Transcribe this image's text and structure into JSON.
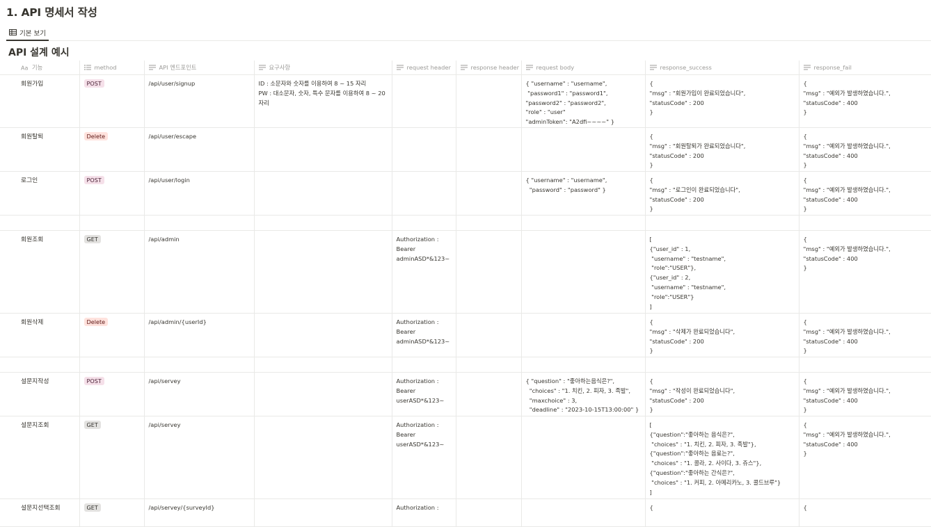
{
  "page": {
    "heading": "1. API 명세서 작성"
  },
  "view": {
    "tab_label": "기본 보기"
  },
  "database": {
    "title": "API 설계 예시"
  },
  "columns": [
    {
      "label": "기능",
      "icon": "title-aa-icon"
    },
    {
      "label": "method",
      "icon": "list-icon"
    },
    {
      "label": "API 엔드포인트",
      "icon": "text-icon"
    },
    {
      "label": "요구사항",
      "icon": "text-icon"
    },
    {
      "label": "request header",
      "icon": "text-icon"
    },
    {
      "label": "response header",
      "icon": "text-icon"
    },
    {
      "label": "request body",
      "icon": "text-icon"
    },
    {
      "label": "response_success",
      "icon": "text-icon"
    },
    {
      "label": "response_fail",
      "icon": "text-icon"
    }
  ],
  "tag_colors": {
    "POST": "#f5e0e9",
    "Delete": "#ffe2dd",
    "GET": "#e3e2e0"
  },
  "rows": [
    {
      "name": "회원가입",
      "method": "POST",
      "endpoint": "/api/user/signup",
      "requirements": "ID : 소문자와 숫자를 이용하여 8 ~ 15 자리\nPW : 대소문자, 숫자, 특수 문자를 이용하여 8 ~ 20 자리",
      "request_header": "",
      "response_header": "",
      "request_body": "{ \"username\" : \"username\",\n \"password1\" : \"password1\",\n\"password2\" : \"password2\",\n\"role\" : \"user\"\n\"adminToken\": \"A2dfi~~~~\" }",
      "response_success": "{\n\"msg\" : \"회원가입이 완료되었습니다\",\n\"statusCode\" : 200\n}",
      "response_fail": "{\n\"msg\" : \"예외가 발생하였습니다.\",\n\"statusCode\" : 400\n}"
    },
    {
      "name": "회원탈퇴",
      "method": "Delete",
      "endpoint": "/api/user/escape",
      "requirements": "",
      "request_header": "",
      "response_header": "",
      "request_body": "",
      "response_success": "{\n\"msg\" : \"회원탈퇴가 완료되었습니다\",\n\"statusCode\" : 200\n}",
      "response_fail": "{\n\"msg\" : \"예외가 발생하였습니다.\",\n\"statusCode\" : 400\n}"
    },
    {
      "name": "로그인",
      "method": "POST",
      "endpoint": "/api/user/login",
      "requirements": "",
      "request_header": "",
      "response_header": "",
      "request_body": "{ \"username\" : \"username\",\n  \"password\" : \"password\" }",
      "response_success": "{\n\"msg\" : \"로그인이 완료되었습니다\",\n\"statusCode\" : 200\n}",
      "response_fail": "{\n\"msg\" : \"예외가 발생하였습니다.\",\n\"statusCode\" : 400\n}"
    },
    {
      "name": "",
      "method": "",
      "endpoint": "",
      "requirements": "",
      "request_header": "",
      "response_header": "",
      "request_body": "",
      "response_success": "",
      "response_fail": ""
    },
    {
      "name": "회원조회",
      "method": "GET",
      "endpoint": "/api/admin",
      "requirements": "",
      "request_header": "Authorization :\nBearer\nadminASD*&123~",
      "response_header": "",
      "request_body": "",
      "response_success": "[\n{\"user_id\" : 1,\n \"username\" : \"testname\",\n \"role\":\"USER\"},\n{\"user_id\" : 2,\n \"username\" : \"testname\",\n \"role\":\"USER\"}\n]",
      "response_fail": "{\n\"msg\" : \"예외가 발생하였습니다.\",\n\"statusCode\" : 400\n}"
    },
    {
      "name": "회원삭제",
      "method": "Delete",
      "endpoint": "/api/admin/{userId}",
      "requirements": "",
      "request_header": "Authorization :\nBearer\nadminASD*&123~",
      "response_header": "",
      "request_body": "",
      "response_success": "{\n\"msg\" : \"삭제가 완료되었습니다\",\n\"statusCode\" : 200\n}",
      "response_fail": "{\n\"msg\" : \"예외가 발생하였습니다.\",\n\"statusCode\" : 400\n}"
    },
    {
      "name": "",
      "method": "",
      "endpoint": "",
      "requirements": "",
      "request_header": "",
      "response_header": "",
      "request_body": "",
      "response_success": "",
      "response_fail": ""
    },
    {
      "name": "설문지작성",
      "method": "POST",
      "endpoint": "/api/servey",
      "requirements": "",
      "request_header": "Authorization :\nBearer\nuserASD*&123~",
      "response_header": "",
      "request_body": "{ \"question\" : \"좋아하는음식은?\",\n  \"choices\" : \"1. 치킨, 2. 피자, 3. 족발\",\n  \"maxchoice\" : 3,\n  \"deadline\" : \"2023-10-15T13:00:00\" }",
      "response_success": "{\n\"msg\" : \"작성이 완료되었습니다\",\n\"statusCode\" : 200\n}",
      "response_fail": "{\n\"msg\" : \"예외가 발생하였습니다.\",\n\"statusCode\" : 400\n}"
    },
    {
      "name": "설문지조회",
      "method": "GET",
      "endpoint": "/api/servey",
      "requirements": "",
      "request_header": "Authorization :\nBearer\nuserASD*&123~",
      "response_header": "",
      "request_body": "",
      "response_success": "[\n{\"question\":\"좋아하는 음식은?\",\n \"choices\" : \"1. 치킨, 2. 피자, 3. 족발\"},\n{\"question\":\"좋아하는 음료는?\",\n \"choices\" : \"1. 콜라, 2. 사이다, 3. 쥬스\"},\n{\"question\":\"좋아하는 간식은?\",\n \"choices\" : \"1. 커피, 2. 아메리카노, 3. 콜드브루\"}\n]",
      "response_fail": "{\n\"msg\" : \"예외가 발생하였습니다.\",\n\"statusCode\" : 400\n}"
    },
    {
      "name": "설문지선택조회",
      "method": "GET",
      "endpoint": "/api/servey/{surveyId}",
      "requirements": "",
      "request_header": "Authorization :",
      "response_header": "",
      "request_body": "",
      "response_success": "{",
      "response_fail": "{"
    }
  ]
}
